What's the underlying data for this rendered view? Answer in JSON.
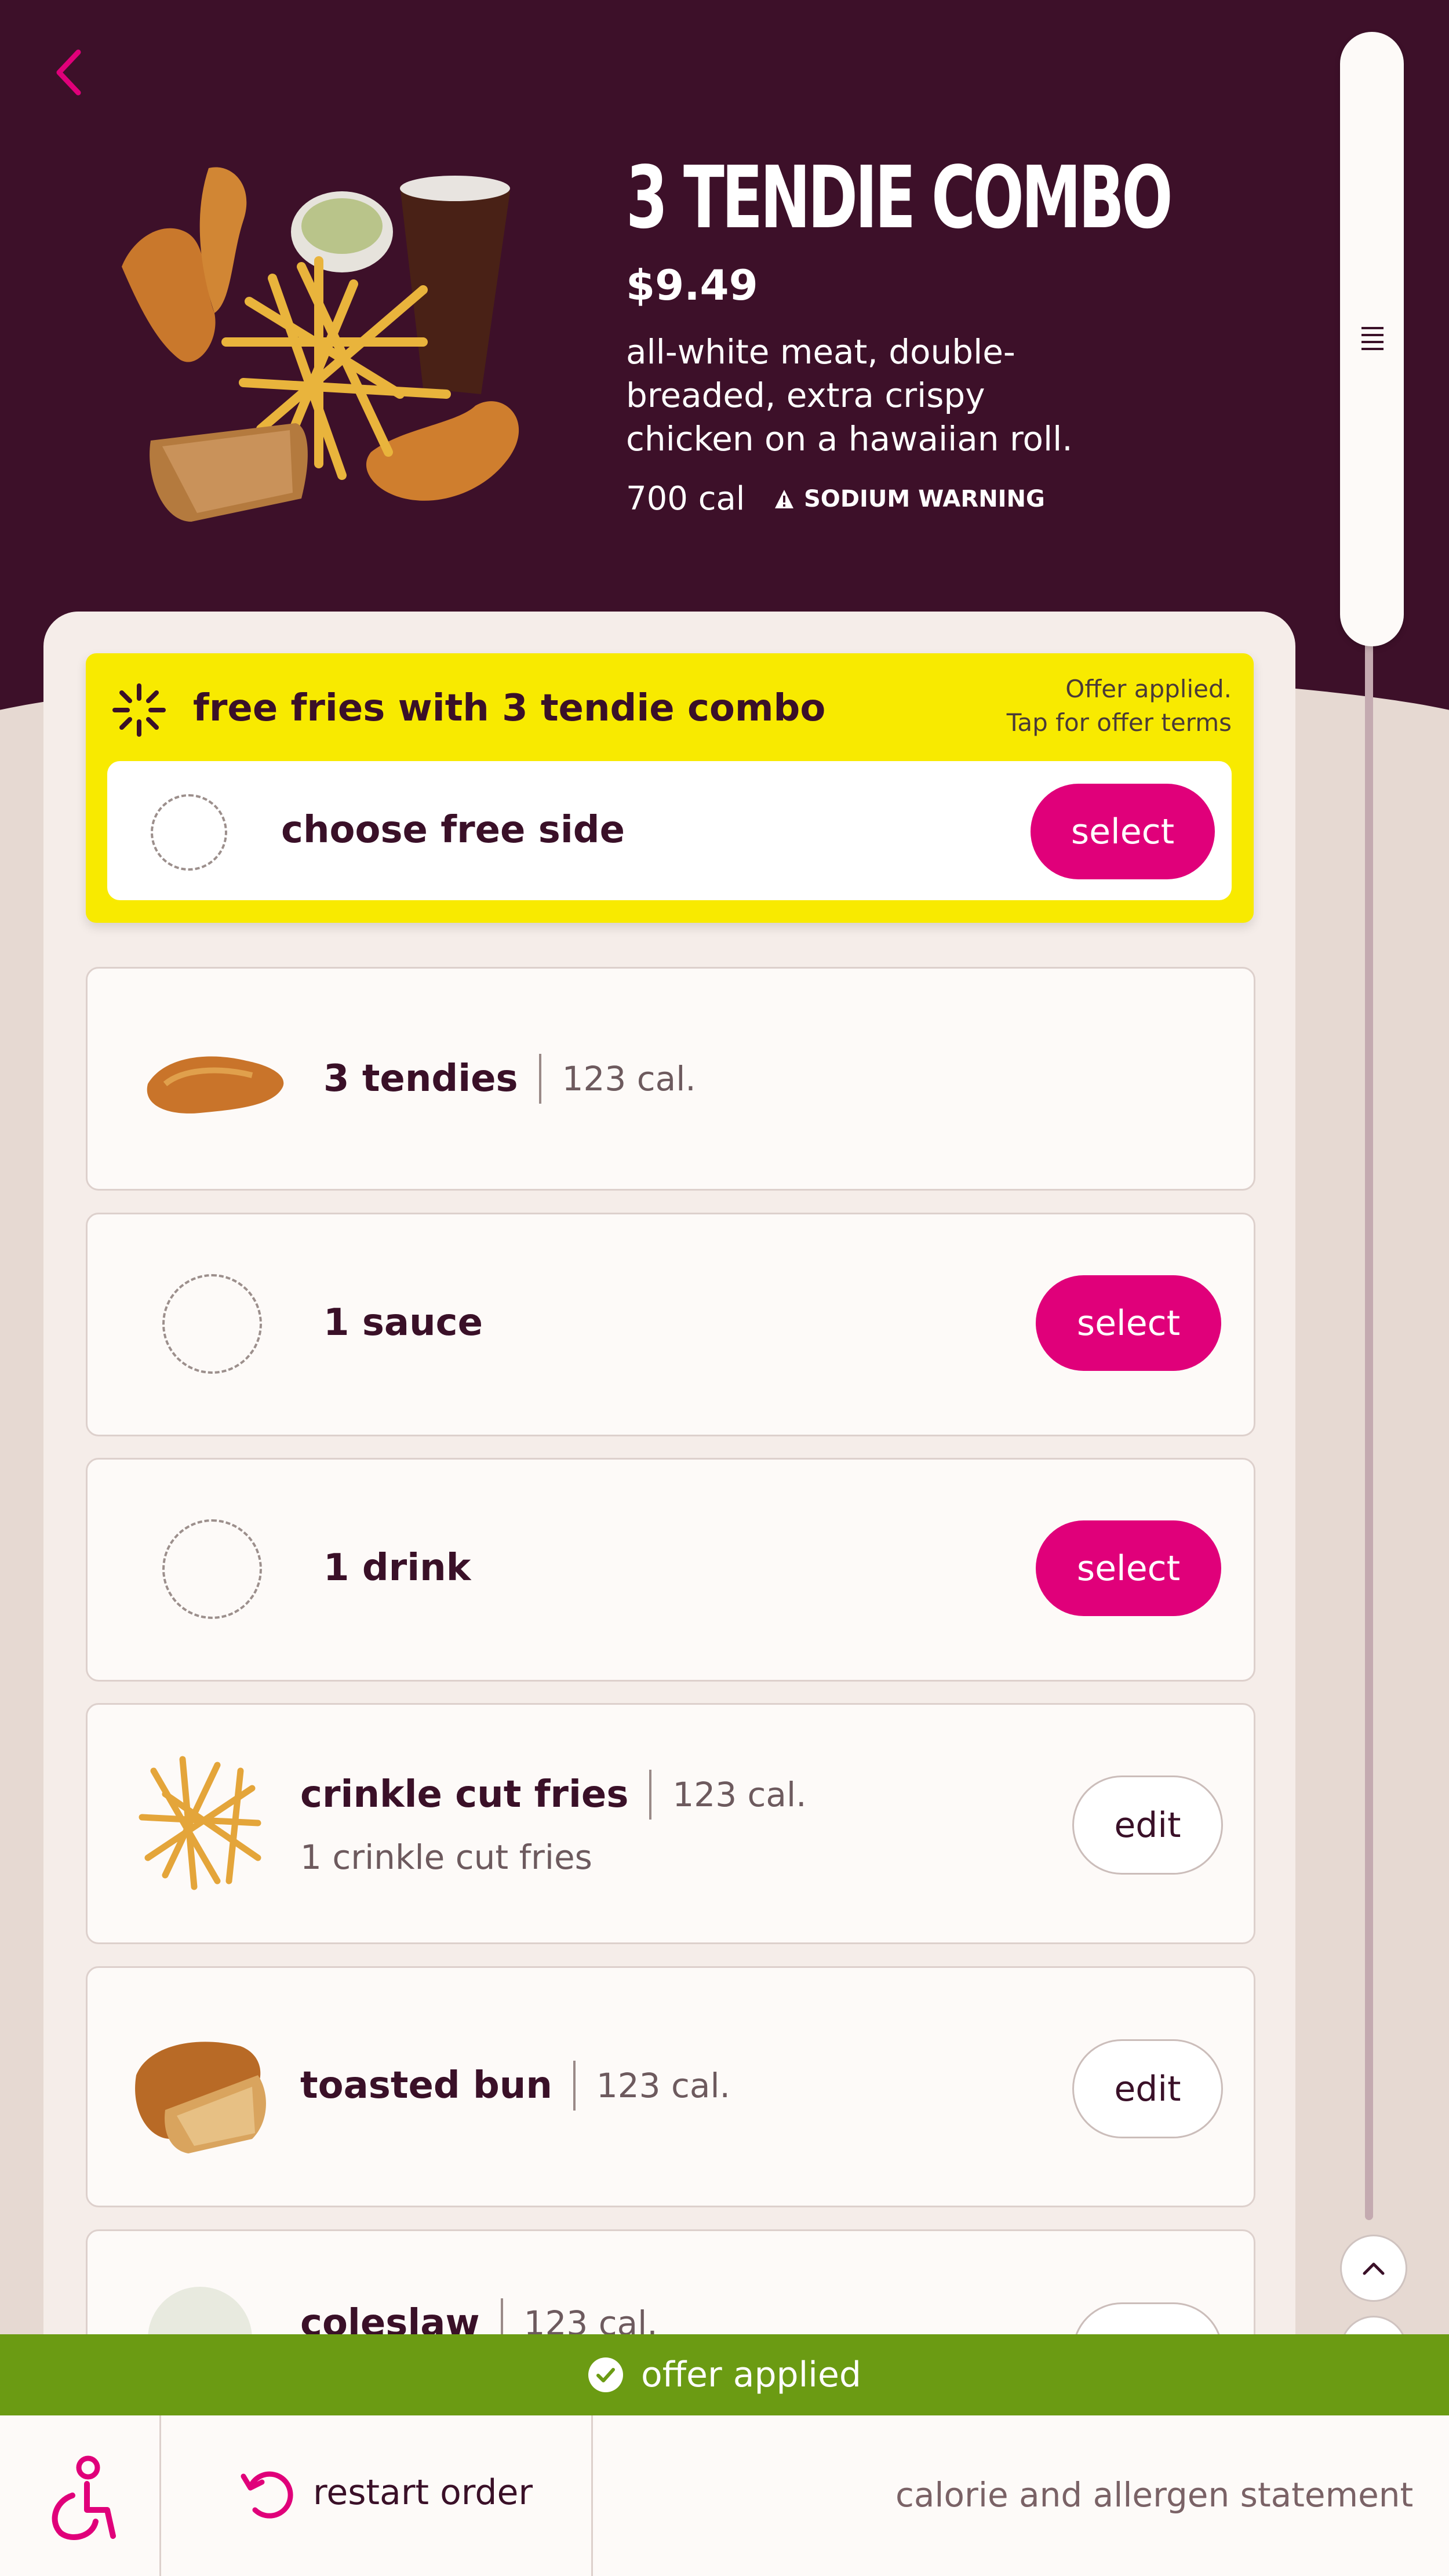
{
  "header": {
    "title": "3 TENDIE COMBO",
    "price": "$9.49",
    "description": "all-white meat, double-breaded, extra crispy chicken on a hawaiian roll.",
    "calories": "700 cal",
    "sodium_warning": "SODIUM WARNING"
  },
  "promo": {
    "title": "free fries with 3 tendie combo",
    "note_line1": "Offer applied.",
    "note_line2": "Tap for offer terms",
    "choice_label": "choose free side",
    "select_label": "select"
  },
  "items": [
    {
      "name": "3 tendies",
      "calories": "123 cal."
    },
    {
      "name": "1 sauce",
      "button": "select"
    },
    {
      "name": "1 drink",
      "button": "select"
    },
    {
      "name": "crinkle cut fries",
      "calories": "123 cal.",
      "detail": "1 crinkle cut fries",
      "button": "edit"
    },
    {
      "name": "toasted bun",
      "calories": "123 cal.",
      "button": "edit"
    },
    {
      "name": "coleslaw",
      "calories": "123 cal."
    }
  ],
  "offer_bar": {
    "label": "offer applied"
  },
  "footer": {
    "restart_label": "restart order",
    "calorie_link": "calorie and allergen statement"
  },
  "colors": {
    "header_bg": "#3d1029",
    "accent_pink": "#e0007a",
    "promo_yellow": "#f8ea00",
    "offer_green": "#6b9b13"
  }
}
